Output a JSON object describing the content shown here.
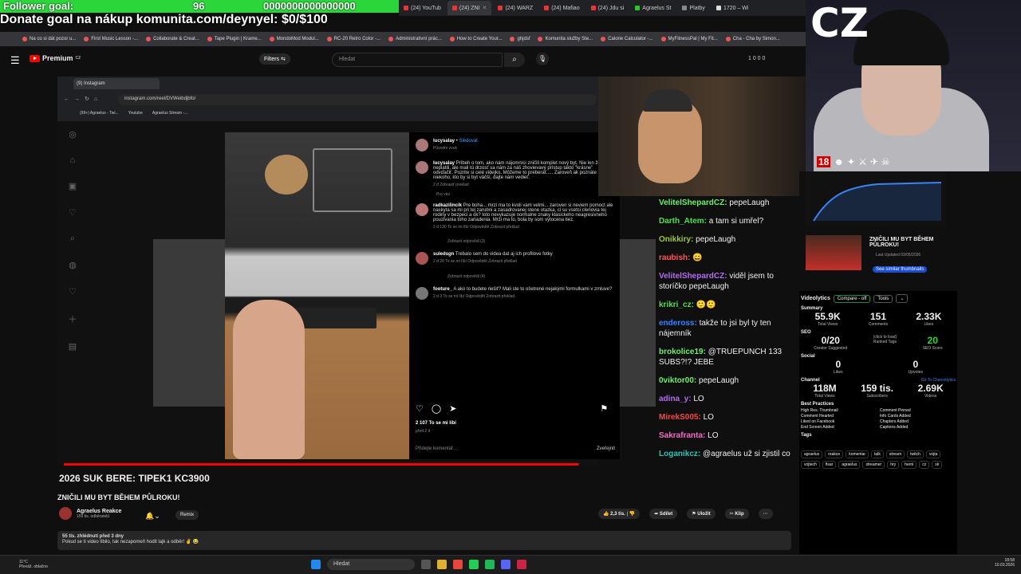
{
  "overlay": {
    "follower_label": "Follower goal:",
    "follower_value": "96",
    "follower_zeros": "0000000000000000",
    "donate": "Donate goal na nákup komunita.com/deynyel: $0/$100",
    "cz_logo": "CZ",
    "badge18": "18"
  },
  "tabs": [
    {
      "label": "(24) YouTub"
    },
    {
      "label": "(24) ZNI"
    },
    {
      "label": "(24) WARZ"
    },
    {
      "label": "(24) Mafiao"
    },
    {
      "label": "(24) Jdu si"
    },
    {
      "label": "Agraelus St"
    },
    {
      "label": "Platby"
    },
    {
      "label": "1720 – Wi"
    }
  ],
  "bookmarks": [
    "Na co si dát pozor u...",
    "First Music Lesson -...",
    "Collaborate & Creat...",
    "Tape Plugin | Krame...",
    "MondoMod Modul...",
    "RC-20 Retro Color -...",
    "Administrativní prác...",
    "How to Create Your...",
    "ghjdsf",
    "Komunita služby Ste...",
    "Calorie Calculator -...",
    "MyFitnessPal | My Fit...",
    "Cha - Cha by Simon..."
  ],
  "youtube": {
    "logo": "Premium",
    "logo_sup": "CZ",
    "filters": "Filters",
    "search_placeholder": "Hledat",
    "right": "1 0 0 0"
  },
  "inner_browser": {
    "tab": "(9) Instagram",
    "address": "instagram.com/reel/DVWeibdjbfo/",
    "bookmarks": [
      "(99+) Agraelus - Twi...",
      "Youtube",
      "Agraelus Stream -..."
    ]
  },
  "instagram": {
    "author": "lucysalay",
    "follow": "Sledovat",
    "audio": "Původní zvuk",
    "caption": "Príbeh o tom, ako nám nájomníci zničili komplet nový byt. Nie len že neplatili, ale mali tú drzosť sa nám za náš zhovievavý prístup takto \"krásne\" odvďačiť. Pozrite si celé videjko. Môžeme to preberať..... Zaroveň ak poznáte niekoho, kto by si byt väčší, dajte nám vedieť.",
    "caption_meta": "2 d    Zobraziť preklad",
    "for_you": "Pro vás",
    "comments": [
      {
        "user": "radkazilincik",
        "text": "Pre boha... mrzí ma to kvoli vam velmi... zaroven si neviem pomoct ale naskyta sa mi pri tej zarubni a zasadrovanej stene otazka, ci su vsetci clenovia tej rodiny v bezpeci a ok? toto nevykazuje normalne znaky klasickeho neagresivneho pouzivania toho zariadenia. Mrzi ma to, bola by som vytocena tiez.",
        "meta": "2 d   130 To se mi líbí   Odpovědět   Zobrazit překlad",
        "replies": "Zobrazit odpovědi (3)"
      },
      {
        "user": "suledsgn",
        "text": "Trebalo sem do videa dat aj ich profilove fotky",
        "meta": "2 d   20 To se mi líbí   Odpovědět   Zobrazit překlad",
        "replies": "Zobrazit odpovědi (4)"
      },
      {
        "user": "footure_",
        "text": "A ako to budete riešiť? Mali ste to ošetrené nejakými formulkami v zmluve?",
        "meta": "2 d   3 To se mi líbí   Odpovědět   Zobrazit překlad",
        "replies": ""
      }
    ],
    "likes": "2 107 To se mi líbí",
    "date": "před 2 d",
    "add_comment": "Přidejte komentář...",
    "post": "Zveřejnit"
  },
  "chat": [
    {
      "user": "VelitelShepardCZ:",
      "text": "pepeLaugh",
      "color": "#6cf06c"
    },
    {
      "user": "Darth_Atem:",
      "text": "a tam si umřel?",
      "color": "#4ce04c"
    },
    {
      "user": "Onikkiry:",
      "text": "pepeLaugh",
      "color": "#9acd32"
    },
    {
      "user": "raubish:",
      "text": "😄",
      "color": "#ff5555"
    },
    {
      "user": "VelitelShepardCZ:",
      "text": "viděl jsem to storíčko pepeLaugh",
      "color": "#b36cf0"
    },
    {
      "user": "krikri_cz:",
      "text": "",
      "color": "#4ce04c"
    },
    {
      "user": "endeross:",
      "text": "takže to jsi byl ty ten nájemník",
      "color": "#3b82f6"
    },
    {
      "user": "brokolice19:",
      "text": "@TRUEPUNCH 133 SUBS?!? JEBE",
      "color": "#6cf06c"
    },
    {
      "user": "0viktor00:",
      "text": "pepeLaugh",
      "color": "#6cf06c"
    },
    {
      "user": "adina_y:",
      "text": "LO",
      "color": "#b36cf0"
    },
    {
      "user": "MirekS005:",
      "text": "LO",
      "color": "#ff4444"
    },
    {
      "user": "Sakrafranta:",
      "text": "LO",
      "color": "#ff66cc"
    },
    {
      "user": "Loganikcz:",
      "text": "@agraelus už si zjistil co",
      "color": "#2ec4b6"
    }
  ],
  "similar": {
    "title": "ZNIČILI MU BYT BĚHEM PŮLROKU!",
    "updated": "Last Updated 03/05/2026",
    "button": "See similar thumbnails"
  },
  "videolytics": {
    "title": "Videolytics",
    "compare": "Compare - off",
    "tools": "Tools",
    "summary": "Summary",
    "views": "55.9K",
    "views_l": "Total Views",
    "comments": "151",
    "comments_l": "Comments",
    "likes": "2.33K",
    "likes_l": "Likes",
    "seo": "SEO",
    "seo_tags": "0/20",
    "seo_tags_l": "Creator Suggested",
    "ranked": "(click to load)",
    "ranked_l": "Ranked Tags",
    "score": "20",
    "score_l": "SEO Score",
    "social": "Social",
    "s_likes": "0",
    "s_likes_l": "Likes",
    "s_up": "0",
    "s_up_l": "Upvotes",
    "channel": "Channel",
    "ch_link": "Go To Channelytics",
    "ch_views": "118M",
    "ch_views_l": "Total Views",
    "ch_subs": "159 tis.",
    "ch_subs_l": "Subscribers",
    "ch_videos": "2.69K",
    "ch_videos_l": "Videos",
    "bp": "Best Practices",
    "bp_items": [
      "High Res. Thumbnail",
      "Comment Pinned",
      "Comment Hearted",
      "Info Cards Added",
      "Liked on Facebook",
      "Chapters Added",
      "End Screen Added",
      "Captions Added",
      ""
    ],
    "tags_label": "Tags",
    "tags": [
      "agraelus",
      "reakce",
      "komentar",
      "talk",
      "stream",
      "twitch",
      "vojta",
      "vojtech",
      "fisar",
      "agraelus",
      "streamer",
      "hry",
      "herni",
      "cz",
      "sk"
    ]
  },
  "player": {
    "ticker": "2026 SUK BERE: TIPEK1 KC3900",
    "title": "ZNIČILI MU BYT BĚHEM PŮLROKU!",
    "channel": "Agraelus Reakce",
    "subs": "159 tis. odběratelů",
    "remix": "Remix",
    "likes": "2,3 tis.",
    "share": "Sdílet",
    "save": "Uložit",
    "clip": "Klip",
    "desc_stats": "55 tis. zhlédnutí  před 3 dny",
    "desc_text": "Pokud se ti video líbilo, tak nezapomeň hodit lajk a odběr! ✌ 😂"
  },
  "taskbar": {
    "temp": "11°C",
    "weather": "Převáž. oblačno",
    "search": "Hledat",
    "time": "18:58",
    "date": "10.03.2026"
  }
}
